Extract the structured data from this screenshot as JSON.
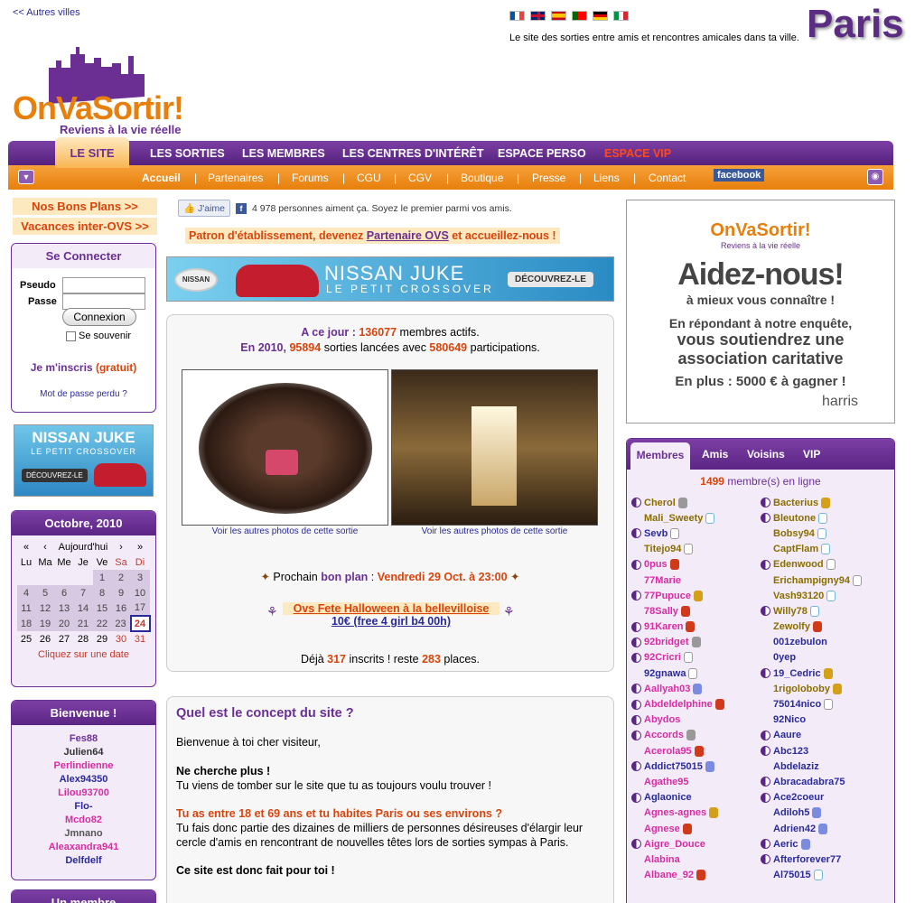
{
  "header": {
    "back_link": "<< Autres villes",
    "tagline": "Le site des sorties entre amis et rencontres amicales dans ta ville.",
    "city": "Paris",
    "logo_text": "OnVaSortir!",
    "logo_slogan": "Reviens à la vie réelle",
    "flags": [
      "fr",
      "gb",
      "es",
      "pt",
      "de",
      "it"
    ]
  },
  "nav": {
    "active_section": "LE SITE",
    "top_items": [
      "LES SORTIES",
      "LES MEMBRES",
      "LES CENTRES D'INTÉRÊT",
      "ESPACE PERSO",
      "ESPACE VIP"
    ],
    "sub_items": [
      "Accueil",
      "Partenaires",
      "Forums",
      "CGU",
      "CGV",
      "Boutique",
      "Presse",
      "Liens",
      "Contact"
    ],
    "facebook": "facebook",
    "colors": {
      "purple": "#6b2f94",
      "orange": "#e77f0c",
      "vip": "#ff4a1a"
    }
  },
  "left": {
    "bons_plans": "Nos Bons Plans >>",
    "vacances": "Vacances inter-OVS >>",
    "login": {
      "title": "Se Connecter",
      "pseudo_label": "Pseudo",
      "passe_label": "Passe",
      "button": "Connexion",
      "remember": "Se souvenir",
      "signup": "Je m'inscris",
      "signup_free": "(gratuit)",
      "lost": "Mot de passe perdu ?"
    },
    "ad": {
      "line1": "NISSAN JUKE",
      "line2": "LE PETIT CROSSOVER",
      "cta": "DÉCOUVREZ-LE"
    },
    "calendar": {
      "month": "Octobre, 2010",
      "nav": [
        "«",
        "‹",
        "Aujourd'hui",
        "›",
        "»"
      ],
      "days": [
        "Lu",
        "Ma",
        "Me",
        "Je",
        "Ve",
        "Sa",
        "Di"
      ],
      "weeks": [
        [
          "",
          "",
          "",
          "",
          "1",
          "2",
          "3"
        ],
        [
          "4",
          "5",
          "6",
          "7",
          "8",
          "9",
          "10"
        ],
        [
          "11",
          "12",
          "13",
          "14",
          "15",
          "16",
          "17"
        ],
        [
          "18",
          "19",
          "20",
          "21",
          "22",
          "23",
          "24"
        ],
        [
          "25",
          "26",
          "27",
          "28",
          "29",
          "30",
          "31"
        ]
      ],
      "today": "24",
      "hint": "Cliquez sur une date"
    },
    "welcome": {
      "title": "Bienvenue !",
      "names": [
        {
          "n": "Fes88",
          "c": "#6b2f94"
        },
        {
          "n": "Julien64",
          "c": "#333333"
        },
        {
          "n": "Perlindienne",
          "c": "#d92ba3"
        },
        {
          "n": "Alex94350",
          "c": "#2a2a9a"
        },
        {
          "n": "Lilou93700",
          "c": "#d92ba3"
        },
        {
          "n": "Flo-",
          "c": "#2a2a9a"
        },
        {
          "n": "Mcdo82",
          "c": "#d92ba3"
        },
        {
          "n": "Jmnano",
          "c": "#555555"
        },
        {
          "n": "Aleaxandra941",
          "c": "#d92ba3"
        },
        {
          "n": "Delfdelf",
          "c": "#2a2a9a"
        }
      ]
    },
    "member_box": "Un membre"
  },
  "center": {
    "like_button": "J'aime",
    "like_text": "4 978 personnes aiment ça. Soyez le premier parmi vos amis.",
    "partner_pre": "Patron d'établissement, devenez ",
    "partner_link": "Partenaire OVS",
    "partner_post": " et accueillez-nous !",
    "banner": {
      "brand": "NISSAN",
      "line1": "NISSAN JUKE",
      "line2": "LE PETIT CROSSOVER",
      "cta": "DÉCOUVREZ-LE"
    },
    "stats": {
      "l1_pre": "A ce jour : ",
      "members": "136077",
      "l1_post": " membres actifs.",
      "l2_pre": "En 2010, ",
      "sorties": "95894",
      "l2_mid": " sorties lancées avec ",
      "participations": "580649",
      "l2_post": " participations."
    },
    "photo_caption": "Voir les autres photos de cette sortie",
    "plan_pre": "Prochain ",
    "plan_label": "bon plan",
    "plan_sep": " : ",
    "plan_date": "Vendredi 29 Oct. à 23:00",
    "event_title": "Ovs Fete Halloween à la bellevilloise",
    "event_price": "10€ (free 4 girl b4 00h)",
    "inscrits_pre": "Déjà ",
    "inscrits": "317",
    "inscrits_mid": " inscrits ! reste ",
    "places": "283",
    "inscrits_post": " places.",
    "concept": {
      "title": "Quel est le concept du site ?",
      "intro": "Bienvenue à toi cher visiteur,",
      "q1": "Ne cherche plus !",
      "a1": "Tu viens de tomber sur le site que tu as toujours voulu trouver !",
      "q2": "Tu as entre 18 et 69 ans et tu habites Paris ou ses environs ?",
      "a2": "Tu fais donc partie des dizaines de milliers de personnes désireuses d'élargir leur cercle d'amis en rencontrant de nouvelles têtes lors de sorties sympas à Paris.",
      "q3": "Ce site est donc fait pour toi !"
    }
  },
  "right": {
    "ad": {
      "logo": "OnVaSortir!",
      "slogan": "Reviens à la vie réelle",
      "h1": "Aidez-nous!",
      "h2": "à mieux vous connaître !",
      "b1": "En répondant à notre enquête,",
      "b2": "vous soutiendrez une",
      "b3": "association caritative",
      "b4": "En plus : 5000 € à gagner !",
      "brand": "harris"
    },
    "tabs": [
      "Membres",
      "Amis",
      "Voisins",
      "VIP"
    ],
    "online_count": "1499",
    "online_label": " membre(s) en ligne",
    "col1": [
      {
        "n": "Cherol",
        "d": 1,
        "i": "g",
        "c": "c2"
      },
      {
        "n": "Mali_Sweety",
        "d": 0,
        "i": "q",
        "c": "c2"
      },
      {
        "n": "Sevb",
        "d": 1,
        "i": "w",
        "c": "c1"
      },
      {
        "n": "Titejo94",
        "d": 0,
        "i": "w",
        "c": "c2"
      },
      {
        "n": "0pus",
        "d": 1,
        "i": "r",
        "c": "c3"
      },
      {
        "n": "77Marie",
        "d": 0,
        "i": "",
        "c": "c3"
      },
      {
        "n": "77Pupuce",
        "d": 1,
        "i": "o",
        "c": "c3"
      },
      {
        "n": "78Sally",
        "d": 0,
        "i": "r",
        "c": "c3"
      },
      {
        "n": "91Karen",
        "d": 1,
        "i": "r",
        "c": "c3"
      },
      {
        "n": "92bridget",
        "d": 1,
        "i": "g",
        "c": "c3"
      },
      {
        "n": "92Cricri",
        "d": 1,
        "i": "w",
        "c": "c3"
      },
      {
        "n": "92gnawa",
        "d": 0,
        "i": "w",
        "c": "c1"
      },
      {
        "n": "Aallyah03",
        "d": 1,
        "i": "b",
        "c": "c3"
      },
      {
        "n": "Abdeldelphine",
        "d": 1,
        "i": "r",
        "c": "c3"
      },
      {
        "n": "Abydos",
        "d": 1,
        "i": "",
        "c": "c3"
      },
      {
        "n": "Accords",
        "d": 1,
        "i": "g",
        "c": "c3"
      },
      {
        "n": "Acerola95",
        "d": 0,
        "i": "r",
        "c": "c3"
      },
      {
        "n": "Addict75015",
        "d": 1,
        "i": "b",
        "c": "c1"
      },
      {
        "n": "Agathe95",
        "d": 0,
        "i": "",
        "c": "c3"
      },
      {
        "n": "Aglaonice",
        "d": 1,
        "i": "",
        "c": "c1"
      },
      {
        "n": "Agnes-agnes",
        "d": 0,
        "i": "o",
        "c": "c3"
      },
      {
        "n": "Agnese",
        "d": 0,
        "i": "r",
        "c": "c3"
      },
      {
        "n": "Aigre_Douce",
        "d": 1,
        "i": "",
        "c": "c3"
      },
      {
        "n": "Alabina",
        "d": 0,
        "i": "",
        "c": "c3"
      },
      {
        "n": "Albane_92",
        "d": 0,
        "i": "r",
        "c": "c3"
      }
    ],
    "col2": [
      {
        "n": "Bacterius",
        "d": 1,
        "i": "o",
        "c": "c2"
      },
      {
        "n": "Bleutone",
        "d": 1,
        "i": "q",
        "c": "c2"
      },
      {
        "n": "Bobsy94",
        "d": 0,
        "i": "q",
        "c": "c2"
      },
      {
        "n": "CaptFlam",
        "d": 0,
        "i": "q",
        "c": "c2"
      },
      {
        "n": "Edenwood",
        "d": 1,
        "i": "w",
        "c": "c2"
      },
      {
        "n": "Erichampigny94",
        "d": 0,
        "i": "w",
        "c": "c2"
      },
      {
        "n": "Vash93120",
        "d": 0,
        "i": "q",
        "c": "c2"
      },
      {
        "n": "Willy78",
        "d": 1,
        "i": "q",
        "c": "c2"
      },
      {
        "n": "Zewolfy",
        "d": 0,
        "i": "r",
        "c": "c2"
      },
      {
        "n": "001zebulon",
        "d": 0,
        "i": "",
        "c": "c1"
      },
      {
        "n": "0yep",
        "d": 0,
        "i": "",
        "c": "c1"
      },
      {
        "n": "19_Cedric",
        "d": 1,
        "i": "o",
        "c": "c1"
      },
      {
        "n": "1rigoloboby",
        "d": 0,
        "i": "o",
        "c": "c2"
      },
      {
        "n": "75014nico",
        "d": 0,
        "i": "w",
        "c": "c1"
      },
      {
        "n": "92Nico",
        "d": 0,
        "i": "",
        "c": "c1"
      },
      {
        "n": "Aaure",
        "d": 1,
        "i": "",
        "c": "c1"
      },
      {
        "n": "Abc123",
        "d": 1,
        "i": "",
        "c": "c1"
      },
      {
        "n": "Abdelaziz",
        "d": 0,
        "i": "",
        "c": "c1"
      },
      {
        "n": "Abracadabra75",
        "d": 1,
        "i": "",
        "c": "c1"
      },
      {
        "n": "Ace2coeur",
        "d": 1,
        "i": "",
        "c": "c1"
      },
      {
        "n": "Adiloh5",
        "d": 0,
        "i": "b",
        "c": "c1"
      },
      {
        "n": "Adrien42",
        "d": 0,
        "i": "b",
        "c": "c1"
      },
      {
        "n": "Aeric",
        "d": 1,
        "i": "b",
        "c": "c1"
      },
      {
        "n": "Afterforever77",
        "d": 1,
        "i": "",
        "c": "c1"
      },
      {
        "n": "Al75015",
        "d": 0,
        "i": "q",
        "c": "c1"
      }
    ]
  }
}
